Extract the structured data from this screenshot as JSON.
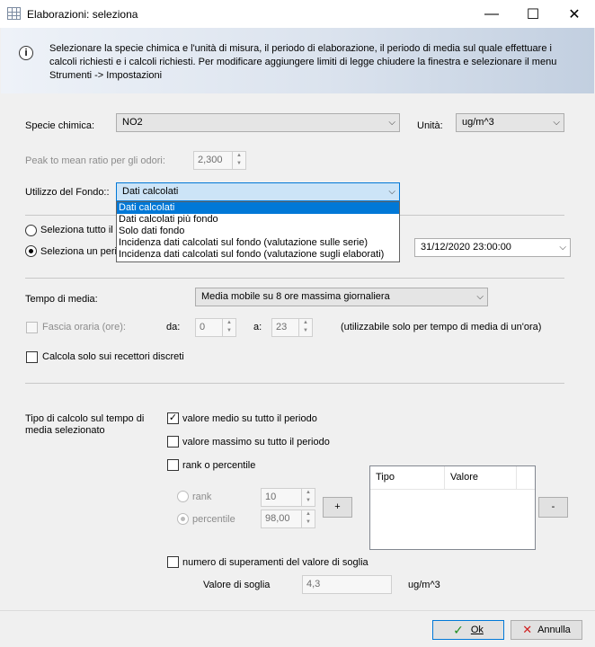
{
  "window": {
    "title": "Elaborazioni: seleziona",
    "minimize": "—",
    "maximize": "☐",
    "close": "✕"
  },
  "info": {
    "text": "Selezionare la specie chimica e l'unità di misura, il periodo di elaborazione, il periodo di media sul quale effettuare i calcoli richiesti e i calcoli richiesti. Per modificare aggiungere limiti di legge chiudere la finestra e selezionare il menu Strumenti -> Impostazioni"
  },
  "specie": {
    "label": "Specie chimica:",
    "value": "NO2"
  },
  "unita": {
    "label": "Unità:",
    "value": "ug/m^3"
  },
  "peak": {
    "label": "Peak to mean ratio per gli odori:",
    "value": "2,300"
  },
  "fondo": {
    "label": "Utilizzo del Fondo::",
    "value": "Dati calcolati",
    "options": [
      "Dati calcolati",
      "Dati calcolati più fondo",
      "Solo dati fondo",
      "Incidenza dati calcolati sul fondo (valutazione sulle serie)",
      "Incidenza dati calcolati sul fondo (valutazione sugli elaborati)"
    ]
  },
  "periodo": {
    "all_label": "Seleziona tutto il p",
    "range_label": "Seleziona un perio",
    "end_date": "31/12/2020 23:00:00"
  },
  "media": {
    "label": "Tempo di media:",
    "value": "Media mobile su 8 ore massima giornaliera"
  },
  "fascia": {
    "label": "Fascia oraria (ore):",
    "da_label": "da:",
    "da_value": "0",
    "a_label": "a:",
    "a_value": "23",
    "note": "(utilizzabile solo per tempo di media di un'ora)"
  },
  "recettori": {
    "label": "Calcola solo sui recettori discreti"
  },
  "calcolo": {
    "label": "Tipo di calcolo sul tempo di media selezionato",
    "medio": "valore medio su tutto il periodo",
    "massimo": "valore massimo su tutto il periodo",
    "rank_perc": "rank o percentile",
    "rank_label": "rank",
    "rank_value": "10",
    "perc_label": "percentile",
    "perc_value": "98,00",
    "add": "+",
    "remove": "-",
    "list_headers": [
      "Tipo",
      "Valore"
    ],
    "superamenti": "numero di superamenti del valore di soglia",
    "soglia_label": "Valore di soglia",
    "soglia_value": "4,3",
    "soglia_unit": "ug/m^3"
  },
  "footer": {
    "ok": "Ok",
    "cancel": "Annulla"
  }
}
